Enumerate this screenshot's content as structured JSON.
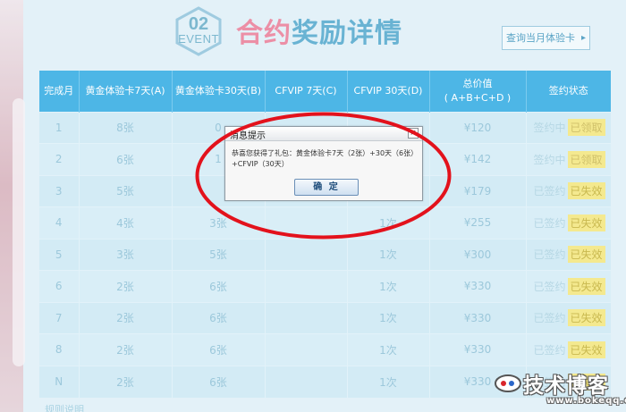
{
  "header": {
    "badge_number": "02",
    "badge_text": "EVENT",
    "title_part1": "合约",
    "title_part2": "奖励详情",
    "query_button": "查询当月体验卡",
    "query_arrow": "▸"
  },
  "table": {
    "columns": [
      "完成月",
      "黄金体验卡7天(A)",
      "黄金体验卡30天(B)",
      "CFVIP 7天(C)",
      "CFVIP 30天(D)",
      "总价值\n( A+B+C+D )",
      "签约状态"
    ],
    "rows": [
      {
        "month": "1",
        "a": "8张",
        "b": "0",
        "c": "",
        "d": "",
        "total": "¥120",
        "signed": "签约中",
        "status": "已领取"
      },
      {
        "month": "2",
        "a": "6张",
        "b": "1",
        "c": "",
        "d": "",
        "total": "¥142",
        "signed": "签约中",
        "status": "已领取"
      },
      {
        "month": "3",
        "a": "5张",
        "b": "",
        "c": "",
        "d": "",
        "total": "¥179",
        "signed": "已签约",
        "status": "已失效"
      },
      {
        "month": "4",
        "a": "4张",
        "b": "3张",
        "c": "",
        "d": "1次",
        "total": "¥255",
        "signed": "已签约",
        "status": "已失效"
      },
      {
        "month": "5",
        "a": "3张",
        "b": "5张",
        "c": "",
        "d": "1次",
        "total": "¥300",
        "signed": "已签约",
        "status": "已失效"
      },
      {
        "month": "6",
        "a": "2张",
        "b": "6张",
        "c": "",
        "d": "1次",
        "total": "¥330",
        "signed": "已签约",
        "status": "已失效"
      },
      {
        "month": "7",
        "a": "2张",
        "b": "6张",
        "c": "",
        "d": "1次",
        "total": "¥330",
        "signed": "已签约",
        "status": "已失效"
      },
      {
        "month": "8",
        "a": "2张",
        "b": "6张",
        "c": "",
        "d": "1次",
        "total": "¥330",
        "signed": "已签约",
        "status": "已失效"
      },
      {
        "month": "N",
        "a": "2张",
        "b": "6张",
        "c": "",
        "d": "1次",
        "total": "¥330",
        "signed": "已签约",
        "status": "已失效"
      }
    ]
  },
  "modal": {
    "title": "消息提示",
    "close": "×",
    "message": "恭喜您获得了礼包：黄金体验卡7天（2张）+30天（6张）+CFVIP（30天）",
    "ok_button": "确 定"
  },
  "footer": {
    "text": "规则说明"
  },
  "watermark": {
    "main": "技术博客",
    "url": "www.bokeqq.com"
  },
  "colors": {
    "header_bg": "#4db6e6",
    "title_pink": "#ec8fa6",
    "title_blue": "#69b3d3",
    "highlight_ellipse": "#e3121c",
    "pill_bg": "#f4e98f"
  }
}
